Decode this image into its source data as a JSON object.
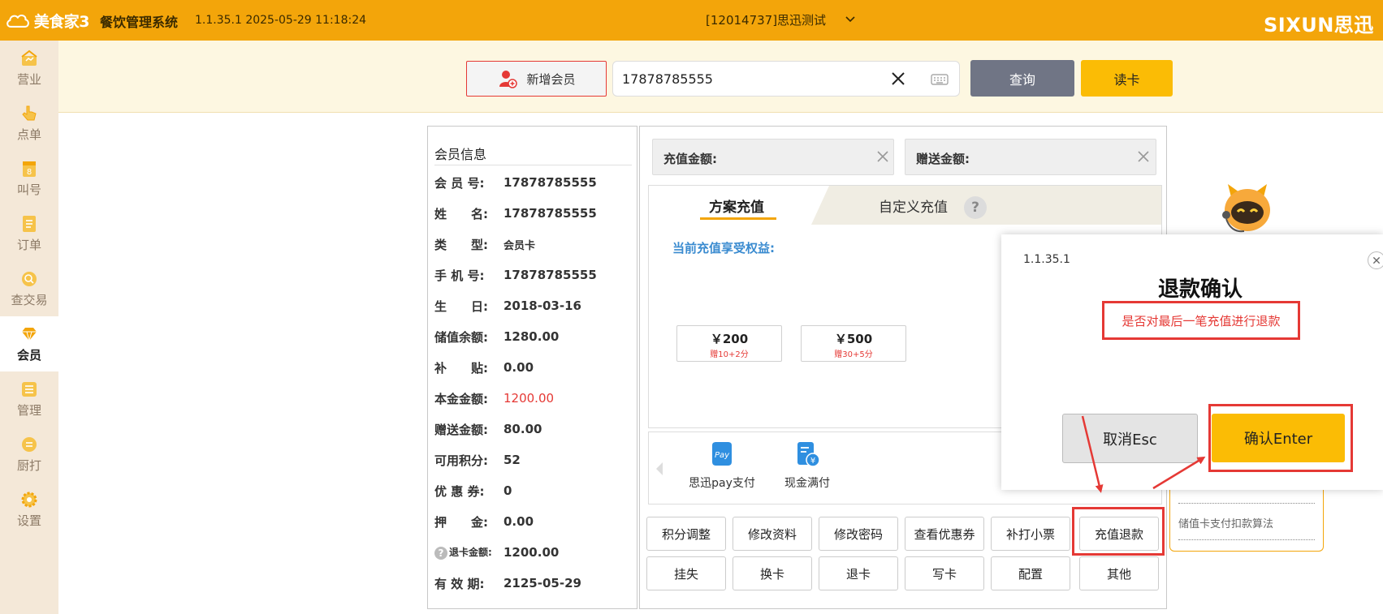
{
  "topbar": {
    "logo_text": "美食家3",
    "app_name": "餐饮管理系统",
    "version_time": "1.1.35.1 2025-05-29 11:18:24",
    "store": "[12014737]思迅测试",
    "brand": "SIXUN思迅",
    "bar_color": "#f3a50a"
  },
  "sidebar": {
    "items": [
      {
        "label": "营业",
        "icon": "shop-icon"
      },
      {
        "label": "点单",
        "icon": "hand-pointer-icon"
      },
      {
        "label": "叫号",
        "icon": "ticket-number-icon"
      },
      {
        "label": "订单",
        "icon": "order-list-icon"
      },
      {
        "label": "查交易",
        "icon": "search-coin-icon"
      },
      {
        "label": "会员",
        "icon": "diamond-icon",
        "active": true
      },
      {
        "label": "管理",
        "icon": "management-icon"
      },
      {
        "label": "厨打",
        "icon": "kitchen-print-icon"
      },
      {
        "label": "设置",
        "icon": "gear-icon"
      }
    ]
  },
  "search": {
    "add_member_label": "新增会员",
    "value": "17878785555",
    "query_label": "查询",
    "read_card_label": "读卡"
  },
  "member": {
    "title": "会员信息",
    "rows": [
      {
        "label": "会 员 号:",
        "value": "17878785555"
      },
      {
        "label": "姓　　名:",
        "value": "17878785555"
      },
      {
        "label": "类　　型:",
        "value": "会员卡"
      },
      {
        "label": "手 机 号:",
        "value": "17878785555"
      },
      {
        "label": "生　　日:",
        "value": "2018-03-16"
      },
      {
        "label": "储值余额:",
        "value": "1280.00"
      },
      {
        "label": "补　　贴:",
        "value": "0.00"
      },
      {
        "label": "本金金额:",
        "value": "1200.00"
      },
      {
        "label": "赠送金额:",
        "value": "80.00"
      },
      {
        "label": "可用积分:",
        "value": "52"
      },
      {
        "label": "优 惠 券:",
        "value": "0"
      },
      {
        "label": "押　　金:",
        "value": "0.00"
      },
      {
        "label": "退卡金额:",
        "value": "1200.00"
      },
      {
        "label": "有 效 期:",
        "value": "2125-05-29"
      }
    ]
  },
  "recharge": {
    "recharge_amount_label": "充值金额:",
    "gift_amount_label": "赠送金额:",
    "tab_plan": "方案充值",
    "tab_custom": "自定义充值",
    "help_mark": "?",
    "benefit_label": "当前充值享受权益:",
    "plans": [
      {
        "price": "￥200",
        "bonus": "赠10+2分"
      },
      {
        "price": "￥500",
        "bonus": "赠30+5分"
      }
    ],
    "pay_methods": [
      {
        "label": "思迅pay支付",
        "badge": "Pay"
      },
      {
        "label": "现金满付",
        "badge": "¥"
      }
    ],
    "actions_row1": [
      "积分调整",
      "修改资料",
      "修改密码",
      "查看优惠券",
      "补打小票",
      "充值退款"
    ],
    "actions_row2": [
      "挂失",
      "换卡",
      "退卡",
      "写卡",
      "配置",
      "其他"
    ]
  },
  "tip": {
    "text": "储值卡支付扣款算法"
  },
  "modal": {
    "version": "1.1.35.1",
    "title": "退款确认",
    "question": "是否对最后一笔充值进行退款",
    "cancel_label": "取消Esc",
    "confirm_label": "确认Enter"
  }
}
